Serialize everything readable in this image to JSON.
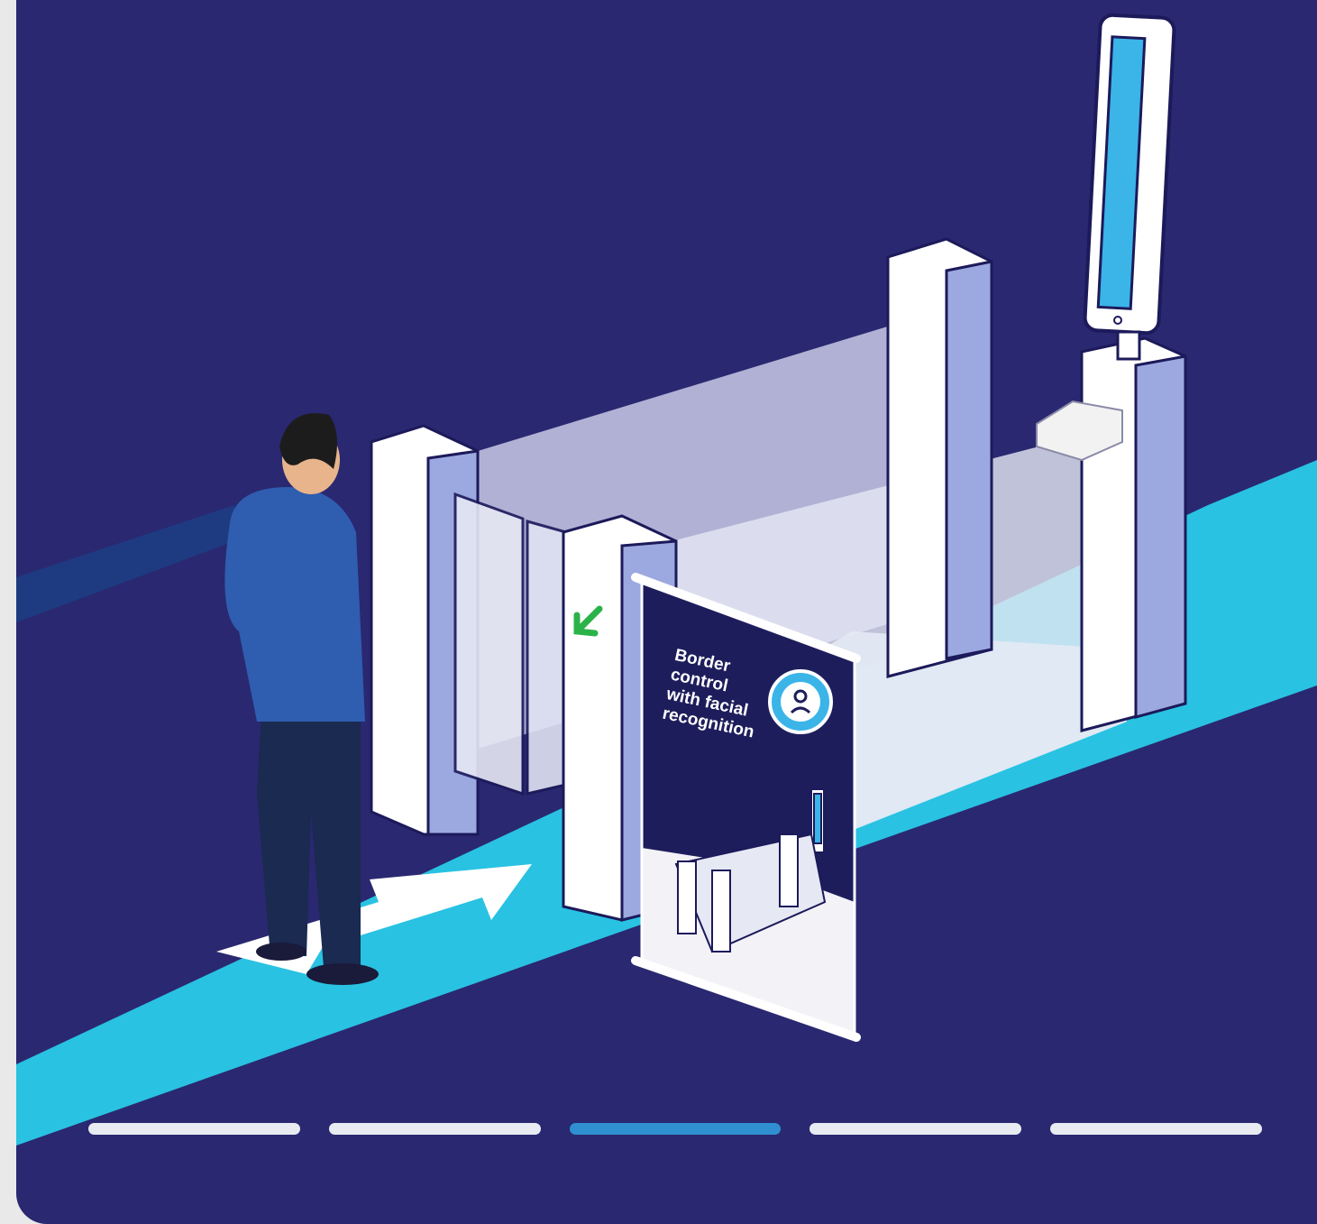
{
  "banner": {
    "line1": "Border",
    "line2": "control",
    "line3": "with facial",
    "line4": "recognition"
  },
  "icons": {
    "face_scan": "face-scan-icon",
    "entry_arrow": "green-arrow-icon",
    "floor_arrow": "floor-arrow-icon"
  },
  "progress": {
    "total_steps": 5,
    "active_step": 3
  },
  "colors": {
    "background": "#2a2870",
    "floor_lane": "#29c2e2",
    "accent_green": "#2bb34a",
    "active_step": "#2f8fd0",
    "inactive_step": "#e8ecf2"
  }
}
